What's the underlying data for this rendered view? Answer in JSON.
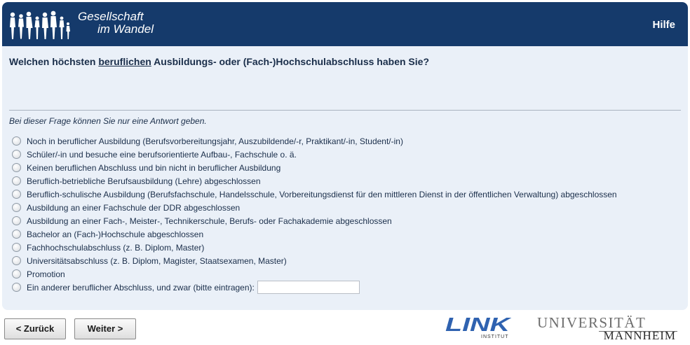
{
  "header": {
    "logo_line1": "Gesellschaft",
    "logo_line2": "im Wandel",
    "help_label": "Hilfe"
  },
  "question": {
    "prefix": "Welchen höchsten ",
    "emphasis": "beruflichen",
    "suffix": " Ausbildungs- oder (Fach-)Hochschulabschluss haben Sie?"
  },
  "hint": "Bei dieser Frage können Sie nur eine Antwort geben.",
  "options": [
    "Noch in beruflicher Ausbildung (Berufsvorbereitungsjahr, Auszubildende/-r, Praktikant/-in, Student/-in)",
    "Schüler/-in und besuche eine berufsorientierte Aufbau-, Fachschule o. ä.",
    "Keinen beruflichen Abschluss und bin nicht in beruflicher Ausbildung",
    "Beruflich-betriebliche Berufsausbildung (Lehre) abgeschlossen",
    "Beruflich-schulische Ausbildung (Berufsfachschule, Handelsschule, Vorbereitungsdienst für den mittleren Dienst in der öffentlichen Verwaltung) abgeschlossen",
    "Ausbildung an einer Fachschule der DDR abgeschlossen",
    "Ausbildung an einer Fach-, Meister-, Technikerschule, Berufs- oder Fachakademie abgeschlossen",
    "Bachelor an (Fach-)Hochschule abgeschlossen",
    "Fachhochschulabschluss (z. B. Diplom, Master)",
    "Universitätsabschluss (z. B. Diplom, Magister, Staatsexamen, Master)",
    "Promotion",
    "Ein anderer beruflicher Abschluss, und zwar (bitte eintragen):"
  ],
  "other_input": {
    "value": ""
  },
  "nav": {
    "back_label": "< Zurück",
    "next_label": "Weiter >"
  },
  "footer": {
    "link_logo_text": "LINK",
    "link_logo_sub": "INSTITUT",
    "uni_logo_top": "UNIVERSITÄT",
    "uni_logo_bottom": "MANNHEIM"
  },
  "colors": {
    "header_bg": "#153a6b",
    "panel_bg": "#eaf0f8",
    "text": "#1a2e4a",
    "link_blue": "#2f62b0"
  }
}
